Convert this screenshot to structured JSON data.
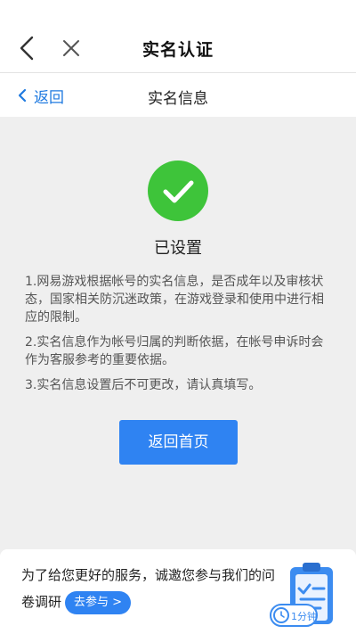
{
  "header": {
    "title": "实名认证",
    "back_icon": "chevron-left-icon",
    "close_icon": "close-icon"
  },
  "subheader": {
    "back_label": "返回",
    "title": "实名信息"
  },
  "main": {
    "status": "已设置",
    "notes": [
      "1.网易游戏根据帐号的实名信息，是否成年以及审核状态，国家相关防沉迷政策，在游戏登录和使用中进行相应的限制。",
      "2.实名信息作为帐号归属的判断依据，在帐号申诉时会作为客服参考的重要依据。",
      "3.实名信息设置后不可更改，请认真填写。"
    ],
    "home_button": "返回首页"
  },
  "survey": {
    "text": "为了给您更好的服务，诚邀您参与我们的问卷调研",
    "join_label": "去参与 >",
    "time_badge": "1分钟"
  },
  "colors": {
    "accent": "#2f83f2",
    "success": "#3ec43a",
    "background": "#efefef"
  }
}
